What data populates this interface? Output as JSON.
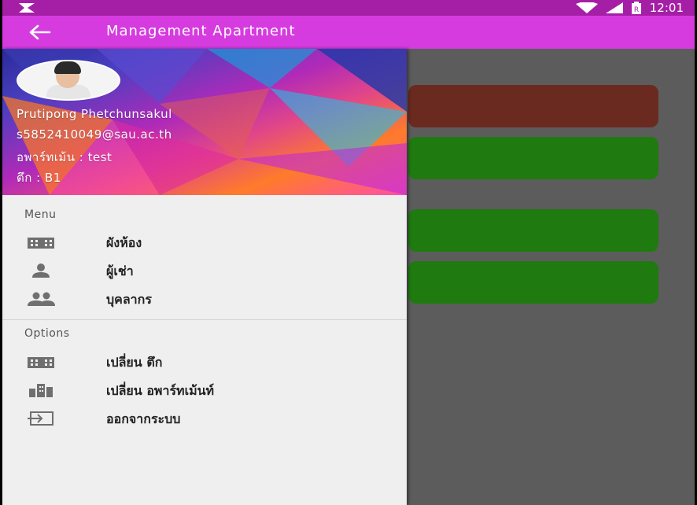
{
  "status_bar": {
    "time": "12:01",
    "icons": [
      "notification-icon",
      "wifi-icon",
      "signal-icon",
      "battery-icon"
    ]
  },
  "app_bar": {
    "title": "Management Apartment",
    "back_icon": "arrow-back-icon"
  },
  "drawer": {
    "header": {
      "name": "Prutipong Phetchunsakul",
      "email": "s5852410049@sau.ac.th",
      "apartment": "อพาร์ทเม้น : test",
      "building": "ตึก : B1"
    },
    "menu": {
      "label": "Menu",
      "items": [
        {
          "label": "ผังห้อง",
          "icon": "building-icon"
        },
        {
          "label": "ผู้เช่า",
          "icon": "person-icon"
        },
        {
          "label": "บุคลากร",
          "icon": "people-icon"
        }
      ]
    },
    "options": {
      "label": "Options",
      "items": [
        {
          "label": "เปลี่ยน ตึก",
          "icon": "building-icon"
        },
        {
          "label": "เปลี่ยน อพาร์ทเม้นท์",
          "icon": "city-icon"
        },
        {
          "label": "ออกจากระบบ",
          "icon": "exit-icon"
        }
      ]
    }
  },
  "colors": {
    "status_bar": "#a51fa6",
    "app_bar": "#d63be0",
    "card_brown": "#6b2a20",
    "card_green": "#1f7a10"
  }
}
